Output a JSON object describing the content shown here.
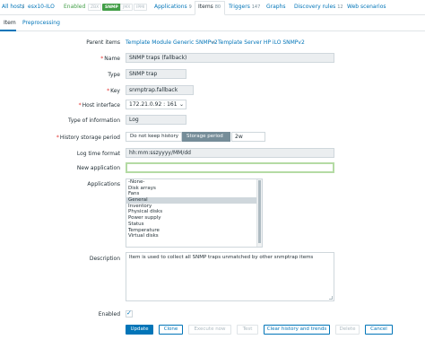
{
  "breadcrumb": {
    "all_hosts": "All hosts",
    "separator": "/",
    "host": "esx10-ILO",
    "status": "Enabled"
  },
  "availability": {
    "zbx": "ZBX",
    "snmp": "SNMP",
    "jmx": "JMX",
    "ipmi": "IPMI"
  },
  "nav": {
    "applications": {
      "label": "Applications",
      "count": "9"
    },
    "items": {
      "label": "Items",
      "count": "80"
    },
    "triggers": {
      "label": "Triggers",
      "count": "147"
    },
    "graphs": {
      "label": "Graphs"
    },
    "discovery": {
      "label": "Discovery rules",
      "count": "12"
    },
    "web": {
      "label": "Web scenarios"
    }
  },
  "tabs": {
    "item": "Item",
    "preprocessing": "Preprocessing"
  },
  "form": {
    "parent_items": {
      "label": "Parent items",
      "first": "Template Module Generic SNMPv2",
      "arrow": "⇒",
      "second": "Template Server HP iLO SNMPv2"
    },
    "name": {
      "required": "*",
      "label": "Name",
      "value": "SNMP traps (fallback)"
    },
    "type": {
      "label": "Type",
      "value": "SNMP trap"
    },
    "key": {
      "required": "*",
      "label": "Key",
      "value": "snmptrap.fallback"
    },
    "host_interface": {
      "required": "*",
      "label": "Host interface",
      "value": "172.21.0.92 : 161"
    },
    "type_of_information": {
      "label": "Type of information",
      "value": "Log"
    },
    "history": {
      "required": "*",
      "label": "History storage period",
      "option_off": "Do not keep history",
      "option_on": "Storage period",
      "value": "2w"
    },
    "log_time_format": {
      "label": "Log time format",
      "value": "hh:mm:sszyyyy/MM/dd"
    },
    "new_application": {
      "label": "New application",
      "value": ""
    },
    "applications": {
      "label": "Applications",
      "options": [
        "-None-",
        "Disk arrays",
        "Fans",
        "General",
        "Inventory",
        "Physical disks",
        "Power supply",
        "Status",
        "Temperature",
        "Virtual disks"
      ],
      "selected": "General"
    },
    "description": {
      "label": "Description",
      "value": "Item is used to collect all SNMP traps unmatched by other snmptrap items"
    },
    "enabled": {
      "label": "Enabled",
      "checked": true
    }
  },
  "buttons": {
    "update": "Update",
    "clone": "Clone",
    "execute_now": "Execute now",
    "test": "Test",
    "clear_history": "Clear history and trends",
    "delete": "Delete",
    "cancel": "Cancel"
  },
  "colors": {
    "link": "#0275b8",
    "enabled_green": "#429e47",
    "required_red": "#e33734",
    "active_segment": "#768d99"
  }
}
